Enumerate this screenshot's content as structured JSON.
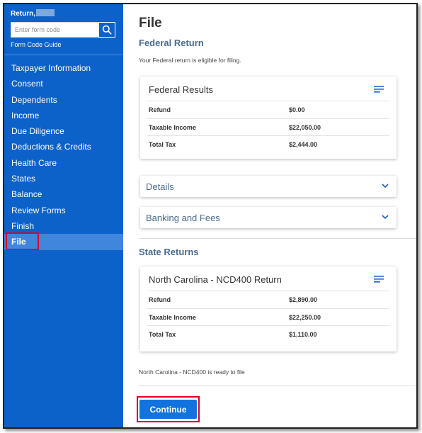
{
  "sidebar": {
    "title": "Return,",
    "search": {
      "placeholder": "Enter form code",
      "value": ""
    },
    "form_code_guide": "Form Code Guide",
    "items": [
      {
        "label": "Taxpayer Information"
      },
      {
        "label": "Consent"
      },
      {
        "label": "Dependents"
      },
      {
        "label": "Income"
      },
      {
        "label": "Due Diligence"
      },
      {
        "label": "Deductions & Credits"
      },
      {
        "label": "Health Care"
      },
      {
        "label": "States"
      },
      {
        "label": "Balance"
      },
      {
        "label": "Review Forms"
      },
      {
        "label": "Finish"
      },
      {
        "label": "File"
      }
    ],
    "active_index": 11
  },
  "main": {
    "page_title": "File",
    "federal": {
      "heading": "Federal Return",
      "eligible_text": "Your Federal return is eligible for filing.",
      "results_card": {
        "title": "Federal Results",
        "rows": [
          {
            "label": "Refund",
            "value": "$0.00"
          },
          {
            "label": "Taxable Income",
            "value": "$22,050.00"
          },
          {
            "label": "Total Tax",
            "value": "$2,444.00"
          }
        ]
      },
      "details_label": "Details",
      "banking_label": "Banking and Fees"
    },
    "state": {
      "heading": "State Returns",
      "card": {
        "title": "North Carolina - NCD400 Return",
        "rows": [
          {
            "label": "Refund",
            "value": "$2,890.00"
          },
          {
            "label": "Taxable Income",
            "value": "$22,250.00"
          },
          {
            "label": "Total Tax",
            "value": "$1,110.00"
          }
        ]
      },
      "ready_text": "North Carolina - NCD400 is ready to file"
    },
    "continue_label": "Continue"
  },
  "colors": {
    "sidebar_bg": "#0d62c9",
    "active_item_bg": "#3f86dc",
    "button_bg": "#1273de",
    "highlight_border": "#e0001b",
    "section_heading": "#4a6a91"
  },
  "icons": {
    "search": "search-icon",
    "card_menu": "menu-icon",
    "expand": "chevron-down-icon"
  }
}
